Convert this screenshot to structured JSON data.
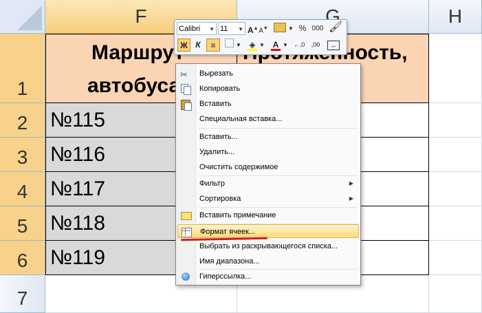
{
  "columns": [
    "F",
    "G",
    "H"
  ],
  "rows": [
    "1",
    "2",
    "3",
    "4",
    "5",
    "6",
    "7"
  ],
  "cells": {
    "f1_line1": "Маршрут",
    "f1_line2": "автобуса",
    "g1": "Протяженность,",
    "f2": "№115",
    "f3": "№116",
    "f4": "№117",
    "f5": "№118",
    "f6": "№119"
  },
  "mini_toolbar": {
    "font": "Calibri",
    "size": "11",
    "grow": "A",
    "shrink": "A",
    "percent": "%",
    "thousands": "000",
    "bold": "Ж",
    "italic": "К"
  },
  "context_menu": {
    "items": [
      {
        "label": "Вырезать",
        "icon": "scissors-icon"
      },
      {
        "label": "Копировать",
        "icon": "copy-icon"
      },
      {
        "label": "Вставить",
        "icon": "paste-icon"
      },
      {
        "label": "Специальная вставка..."
      },
      {
        "label": "Вставить..."
      },
      {
        "label": "Удалить..."
      },
      {
        "label": "Очистить содержимое"
      },
      {
        "label": "Фильтр"
      },
      {
        "label": "Сортировка"
      },
      {
        "label": "Вставить примечание",
        "icon": "comment-icon"
      },
      {
        "label": "Формат ячеек...",
        "icon": "format-cells-icon"
      },
      {
        "label": "Выбрать из раскрывающегося списка..."
      },
      {
        "label": "Имя диапазона..."
      },
      {
        "label": "Гиперссылка...",
        "icon": "hyperlink-icon"
      }
    ]
  },
  "colors": {
    "header_fill": "#fbd4b4",
    "data_fill": "#d9d9d9",
    "selected_header": "#f8d28a",
    "highlight": "#ffd97a",
    "annotation": "#d21f1f"
  }
}
